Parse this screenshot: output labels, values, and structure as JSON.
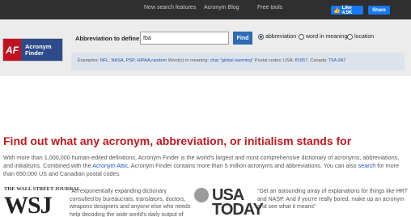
{
  "topnav": {
    "links": [
      "New search features",
      "Acronym Blog",
      "Free tools"
    ]
  },
  "social": {
    "like_label": "Like 4.5K",
    "share_label": "Share"
  },
  "logo": {
    "mark": "AF",
    "name_line1": "Acronym",
    "name_line2": "Finder"
  },
  "search": {
    "label": "Abbreviation to define",
    "value": "fba",
    "button": "Find",
    "options": [
      {
        "label": "abbreviation",
        "selected": true
      },
      {
        "label": "word in meaning",
        "selected": false
      },
      {
        "label": "location",
        "selected": false
      }
    ]
  },
  "examples": {
    "prefix": "Examples:",
    "abbr_links": [
      "NFL",
      "NASA",
      "PSP",
      "HIPAA"
    ],
    "random": "random",
    "word_label": "Word(s) in meaning:",
    "word_links": [
      "chat",
      "\"global warming\""
    ],
    "postal_label": "Postal codes: USA:",
    "usa_code": "81657",
    "canada_label": "Canada:",
    "canada_code": "T5A 0A7"
  },
  "main": {
    "headline": "Find out what any acronym, abbreviation, or initialism stands for",
    "intro_1": "With more than 1,000,000 human-edited definitions, Acronym Finder is the world's largest and most comprehensive dictionary of acronyms, abbreviations, and initialisms. Combined with the ",
    "intro_link_1": "Acronym Attic",
    "intro_2": ", Acronym Finder contains more than 5 million acronyms and abbreviations. You can also ",
    "intro_link_2": "search",
    "intro_3": " for more than 650,000 US and Canadian postal codes."
  },
  "press": {
    "wsj_name": "THE WALL STREET JOURNAL",
    "wsj_logo": "WSJ",
    "wsj_quote": "\"An exponentially expanding dictionary consulted by bureaucrats, translators, doctors, weapons designers and anyone else who needs help decoding the wide world's daily output of",
    "usatoday_line1": "USA",
    "usatoday_line2": "TODAY",
    "usatoday_quote": "\"Get an astounding array of explanations for things like HRT and NASP. And if you're really bored, make up an acronym and see what it means\""
  }
}
